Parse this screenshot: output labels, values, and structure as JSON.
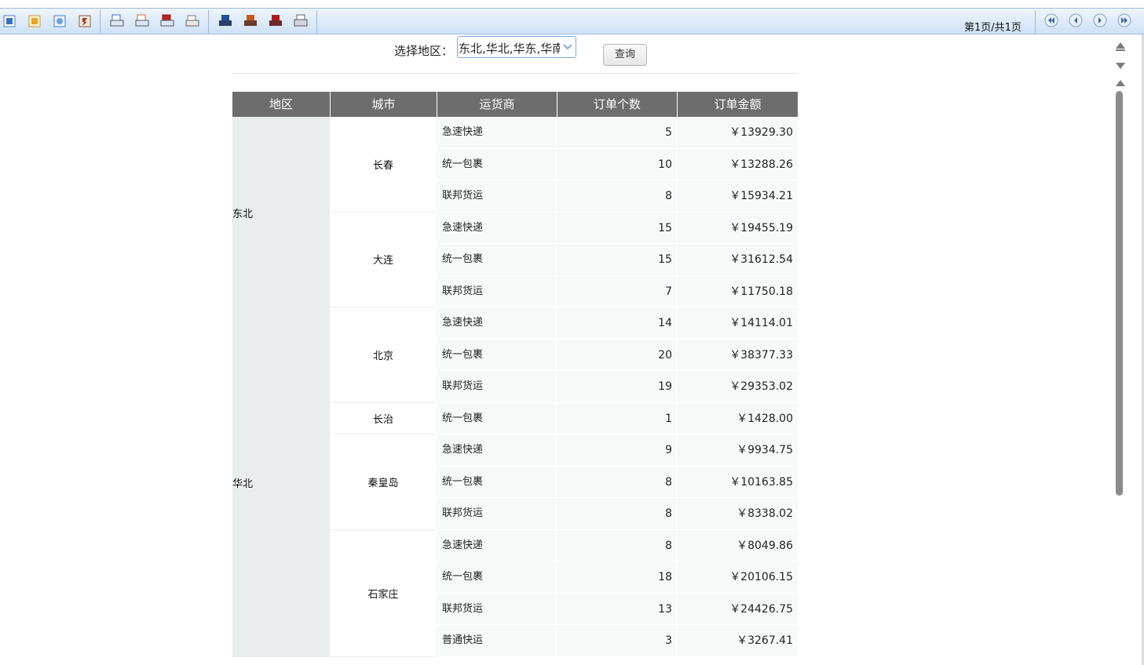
{
  "toolbar": {
    "icons": [
      "word-export-icon",
      "excel-export-icon",
      "image-export-icon",
      "flash-export-icon",
      "print-preview-icon",
      "excel-print-icon",
      "pdf-print-icon",
      "direct-print-icon",
      "word-save-icon",
      "excel-save-icon",
      "pdf-save-icon",
      "printer-icon"
    ],
    "page_info": "第1页/共1页",
    "nav": [
      "first-page-icon",
      "prev-page-icon",
      "next-page-icon",
      "last-page-icon"
    ]
  },
  "query": {
    "label": "选择地区：",
    "select_value": "东北,华北,华东,华南",
    "button_label": "查询"
  },
  "table": {
    "headers": [
      "地区",
      "城市",
      "运货商",
      "订单个数",
      "订单金额"
    ],
    "regions": [
      {
        "name": "东北",
        "cities": [
          {
            "name": "长春",
            "rows": [
              {
                "shipper": "急速快递",
                "count": "5",
                "amount": "￥13929.30"
              },
              {
                "shipper": "统一包裹",
                "count": "10",
                "amount": "￥13288.26"
              },
              {
                "shipper": "联邦货运",
                "count": "8",
                "amount": "￥15934.21"
              }
            ]
          },
          {
            "name": "大连",
            "rows": [
              {
                "shipper": "急速快递",
                "count": "15",
                "amount": "￥19455.19"
              },
              {
                "shipper": "统一包裹",
                "count": "15",
                "amount": "￥31612.54"
              },
              {
                "shipper": "联邦货运",
                "count": "7",
                "amount": "￥11750.18"
              }
            ]
          }
        ]
      },
      {
        "name": "华北",
        "cities": [
          {
            "name": "北京",
            "rows": [
              {
                "shipper": "急速快递",
                "count": "14",
                "amount": "￥14114.01"
              },
              {
                "shipper": "统一包裹",
                "count": "20",
                "amount": "￥38377.33"
              },
              {
                "shipper": "联邦货运",
                "count": "19",
                "amount": "￥29353.02"
              }
            ]
          },
          {
            "name": "长治",
            "rows": [
              {
                "shipper": "统一包裹",
                "count": "1",
                "amount": "￥1428.00"
              }
            ]
          },
          {
            "name": "秦皇岛",
            "rows": [
              {
                "shipper": "急速快递",
                "count": "9",
                "amount": "￥9934.75"
              },
              {
                "shipper": "统一包裹",
                "count": "8",
                "amount": "￥10163.85"
              },
              {
                "shipper": "联邦货运",
                "count": "8",
                "amount": "￥8338.02"
              }
            ]
          },
          {
            "name": "石家庄",
            "rows": [
              {
                "shipper": "急速快递",
                "count": "8",
                "amount": "￥8049.86"
              },
              {
                "shipper": "统一包裹",
                "count": "18",
                "amount": "￥20106.15"
              },
              {
                "shipper": "联邦货运",
                "count": "13",
                "amount": "￥24426.75"
              },
              {
                "shipper": "普通快运",
                "count": "3",
                "amount": "￥3267.41"
              }
            ]
          }
        ]
      }
    ]
  },
  "scrollbar": {
    "icons": [
      "scroll-top-icon",
      "scroll-down-icon",
      "scroll-up-icon"
    ]
  }
}
